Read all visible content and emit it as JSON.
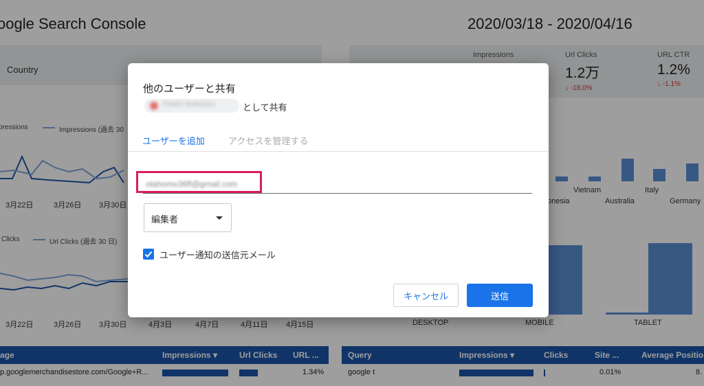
{
  "dashboard": {
    "title": "oogle Search Console",
    "date_range": "2020/03/18 - 2020/04/16",
    "country_filter_label": "Country",
    "metrics": [
      {
        "label": "Impressions",
        "value": "",
        "delta": ""
      },
      {
        "label": "Url Clicks",
        "value": "1.2万",
        "delta": "-18.0%"
      },
      {
        "label": "URL CTR",
        "value": "1.2%",
        "delta": "-1.1%"
      }
    ],
    "chart1_legend": [
      "pressions",
      "Impressions (過去 30"
    ],
    "chart2_legend": [
      "Clicks",
      "Url Clicks (過去 30 日)"
    ],
    "chart1_x_ticks": [
      "3月22日",
      "3月26日",
      "3月30日"
    ],
    "chart2_x_ticks": [
      "3月22日",
      "3月26日",
      "3月30日",
      "4月3日",
      "4月7日",
      "4月11日",
      "4月15日"
    ],
    "country_bar_labels_row1": [
      "Vietnam",
      "Italy"
    ],
    "country_bar_labels_row2": [
      "onesia",
      "Australia",
      "Germany"
    ],
    "device_labels": [
      "DESKTOP",
      "MOBILE",
      "TABLET"
    ],
    "device_bar_values": [
      0,
      0.78,
      0.02,
      0.8
    ],
    "country_bar_values": [
      0.15,
      0.15,
      0.75,
      0.4,
      0.6
    ],
    "page_table": {
      "headers": [
        "age",
        "Impressions ▾",
        "Url Clicks",
        "URL ..."
      ],
      "row": {
        "page": "p.googlemerchandisestore.com/Google+R...",
        "impressions_frac": 1.0,
        "clicks_frac": 0.3,
        "ctr": "1.34%"
      }
    },
    "query_table": {
      "headers": [
        "Query",
        "Impressions ▾",
        "Clicks",
        "Site ...",
        "Average Positio"
      ],
      "row": {
        "query": "google t",
        "impressions_frac": 1.0,
        "clicks_frac": 0.05,
        "site": "0.01%",
        "avg_pos": "8."
      }
    }
  },
  "dialog": {
    "title": "他のユーザーと共有",
    "owner_name": "TOMO SHINOZU",
    "shared_as": "として共有",
    "tabs": {
      "add_user": "ユーザーを追加",
      "manage_access": "アクセスを管理する"
    },
    "email_value": "otahomo36ff@gmail.com",
    "role": "編集者",
    "notify_label": "ユーザー通知の送信元メール",
    "notify_checked": true,
    "cancel_label": "キャンセル",
    "send_label": "送信",
    "accent_color": "#1a73e8",
    "highlight_color": "#d81b60"
  }
}
